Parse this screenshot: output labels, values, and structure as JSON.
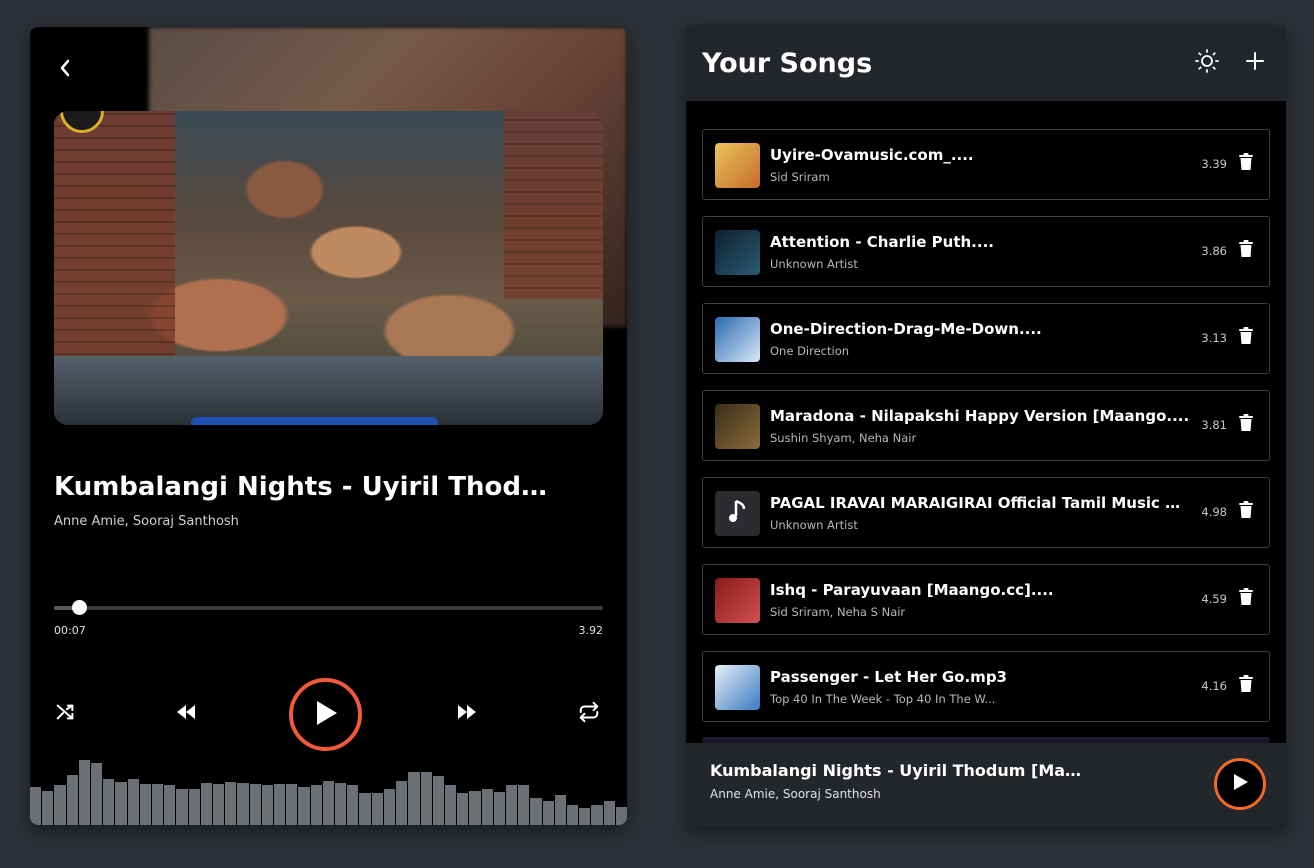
{
  "player": {
    "title": "Kumbalangi Nights - Uyiril Thodu...",
    "artist": "Anne Amie, Sooraj Santhosh",
    "time_current": "00:07",
    "time_total": "3.92",
    "progress_fraction": 0.045,
    "visualizer_levels": [
      0.58,
      0.52,
      0.6,
      0.75,
      0.98,
      0.94,
      0.7,
      0.65,
      0.7,
      0.62,
      0.62,
      0.6,
      0.55,
      0.55,
      0.64,
      0.62,
      0.65,
      0.64,
      0.62,
      0.6,
      0.62,
      0.62,
      0.58,
      0.6,
      0.66,
      0.64,
      0.6,
      0.48,
      0.48,
      0.55,
      0.66,
      0.8,
      0.8,
      0.74,
      0.6,
      0.48,
      0.52,
      0.55,
      0.5,
      0.6,
      0.6,
      0.41,
      0.37,
      0.45,
      0.3,
      0.26,
      0.3,
      0.36,
      0.28
    ]
  },
  "songs_panel": {
    "title": "Your Songs",
    "songs": [
      {
        "name": "Uyire-Ovamusic.com_....",
        "artist": "Sid Sriram",
        "duration": "3.39",
        "thumb_colors": [
          "#e8c55a",
          "#c86a2a"
        ]
      },
      {
        "name": "Attention - Charlie Puth....",
        "artist": "Unknown Artist",
        "duration": "3.86",
        "thumb_colors": [
          "#0e2030",
          "#2a5a70"
        ]
      },
      {
        "name": "One-Direction-Drag-Me-Down....",
        "artist": "One Direction",
        "duration": "3.13",
        "thumb_colors": [
          "#2a6ab0",
          "#d8e8f8"
        ]
      },
      {
        "name": "Maradona - Nilapakshi Happy Version [Maango....",
        "artist": "Sushin Shyam, Neha Nair",
        "duration": "3.81",
        "thumb_colors": [
          "#3a2e1a",
          "#8a6a3a"
        ]
      },
      {
        "name": "PAGAL IRAVAI MARAIGIRAI Official Tamil Music Vid...",
        "artist": "Unknown Artist",
        "duration": "4.98",
        "thumb_colors": [
          "#2a2c30",
          "#2a2c30"
        ]
      },
      {
        "name": "Ishq - Parayuvaan [Maango.cc]....",
        "artist": "Sid Sriram, Neha S Nair",
        "duration": "4.59",
        "thumb_colors": [
          "#8a1a1a",
          "#d05050"
        ]
      },
      {
        "name": "Passenger - Let Her Go.mp3",
        "artist": "Top 40 In The Week - Top 40 In The W...",
        "duration": "4.16",
        "thumb_colors": [
          "#e8f0f8",
          "#3a7ac0"
        ]
      }
    ]
  },
  "mini_player": {
    "title": "Kumbalangi Nights - Uyiril Thodum [Maang...",
    "artist": "Anne Amie, Sooraj Santhosh"
  },
  "colors": {
    "accent": "#ef5a3a",
    "panel": "#23262b",
    "background": "#2d3137",
    "visualizer": "#6b6f76"
  },
  "icons": {
    "back": "chevron-left-icon",
    "shuffle": "shuffle-icon",
    "rewind": "rewind-icon",
    "play": "play-icon",
    "forward": "fast-forward-icon",
    "repeat": "repeat-icon",
    "theme": "sun-icon",
    "add": "plus-icon",
    "delete": "trash-icon",
    "music_note": "music-note-icon"
  }
}
